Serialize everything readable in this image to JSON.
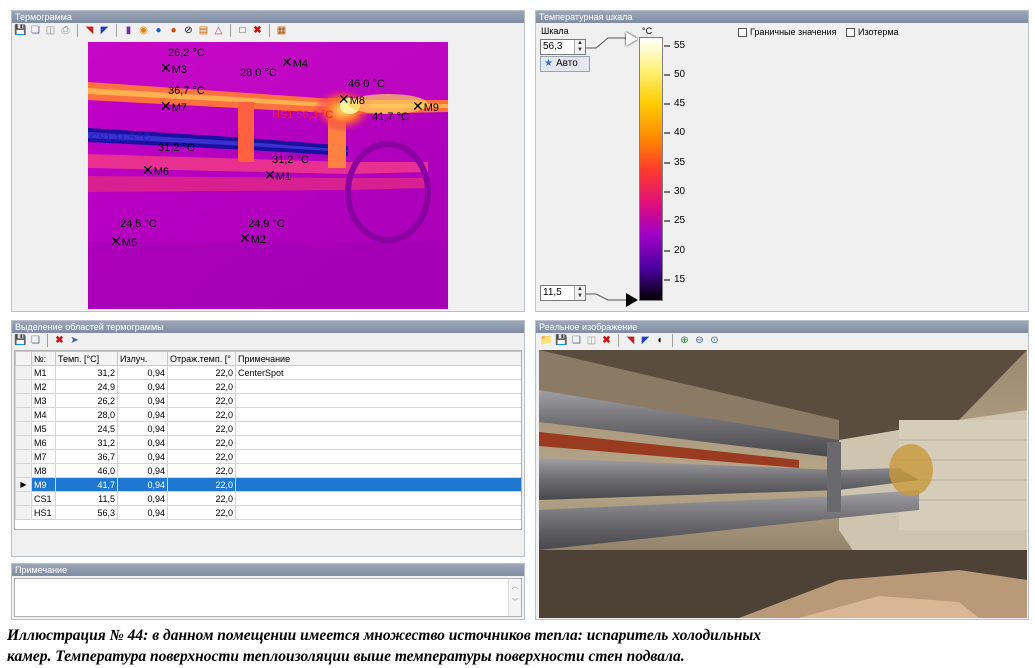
{
  "panels": {
    "thermogram_title": "Термограмма",
    "scale_title": "Температурная шкала",
    "regions_title": "Выделение областей термограммы",
    "note_title": "Примечание",
    "real_title": "Реальное изображение"
  },
  "markers": [
    {
      "name": "M1",
      "temp": "31,2 °C"
    },
    {
      "name": "M2",
      "temp": "24,9 °C"
    },
    {
      "name": "M3",
      "temp": "26,2 °C"
    },
    {
      "name": "M4",
      "temp": "28,0 °C"
    },
    {
      "name": "M5",
      "temp": "24,5 °C"
    },
    {
      "name": "M6",
      "temp": "31,2 °C"
    },
    {
      "name": "M7",
      "temp": "36,7 °C"
    },
    {
      "name": "M8",
      "temp": "46,0 °C"
    },
    {
      "name": "M9",
      "temp": "41,7 °C"
    }
  ],
  "hotspot_label": "HS1 56,3 °C",
  "coldspot_label": "CS1 11,5 °C",
  "scale": {
    "label": "Шкала",
    "max_value": "56,3",
    "min_value": "11,5",
    "auto_label": "Авто",
    "unit": "°C",
    "ticks": [
      "55",
      "50",
      "45",
      "40",
      "35",
      "30",
      "25",
      "20",
      "15"
    ],
    "boundary_label": "Граничные значения",
    "isotherm_label": "Изотерма"
  },
  "table": {
    "headers": [
      "№:",
      "Темп. [°C]",
      "Излуч.",
      "Отраж.темп. [°",
      "Примечание"
    ],
    "rows": [
      {
        "id": "M1",
        "temp": "31,2",
        "emis": "0,94",
        "refl": "22,0",
        "note": "CenterSpot"
      },
      {
        "id": "M2",
        "temp": "24,9",
        "emis": "0,94",
        "refl": "22,0",
        "note": ""
      },
      {
        "id": "M3",
        "temp": "26,2",
        "emis": "0,94",
        "refl": "22,0",
        "note": ""
      },
      {
        "id": "M4",
        "temp": "28,0",
        "emis": "0,94",
        "refl": "22,0",
        "note": ""
      },
      {
        "id": "M5",
        "temp": "24,5",
        "emis": "0,94",
        "refl": "22,0",
        "note": ""
      },
      {
        "id": "M6",
        "temp": "31,2",
        "emis": "0,94",
        "refl": "22,0",
        "note": ""
      },
      {
        "id": "M7",
        "temp": "36,7",
        "emis": "0,94",
        "refl": "22,0",
        "note": ""
      },
      {
        "id": "M8",
        "temp": "46,0",
        "emis": "0,94",
        "refl": "22,0",
        "note": ""
      },
      {
        "id": "M9",
        "temp": "41,7",
        "emis": "0,94",
        "refl": "22,0",
        "note": ""
      },
      {
        "id": "CS1",
        "temp": "11,5",
        "emis": "0,94",
        "refl": "22,0",
        "note": ""
      },
      {
        "id": "HS1",
        "temp": "56,3",
        "emis": "0,94",
        "refl": "22,0",
        "note": ""
      }
    ],
    "selected_index": 8
  },
  "caption": {
    "line1": "Иллюстрация № 44: в данном помещении имеется множество источников тепла: испаритель холодильных",
    "line2": "камер. Температура поверхности теплоизоляции выше температуры поверхности стен подвала."
  },
  "colors": {
    "selection": "#1e78d2",
    "hotspot_text": "#ff2020",
    "coldspot_text": "#2020c0",
    "palette": [
      "#ffffff",
      "#fff27a",
      "#ffcc00",
      "#ff8a00",
      "#ff3c2a",
      "#e0107a",
      "#a000c8",
      "#4a00a0",
      "#000000"
    ]
  }
}
